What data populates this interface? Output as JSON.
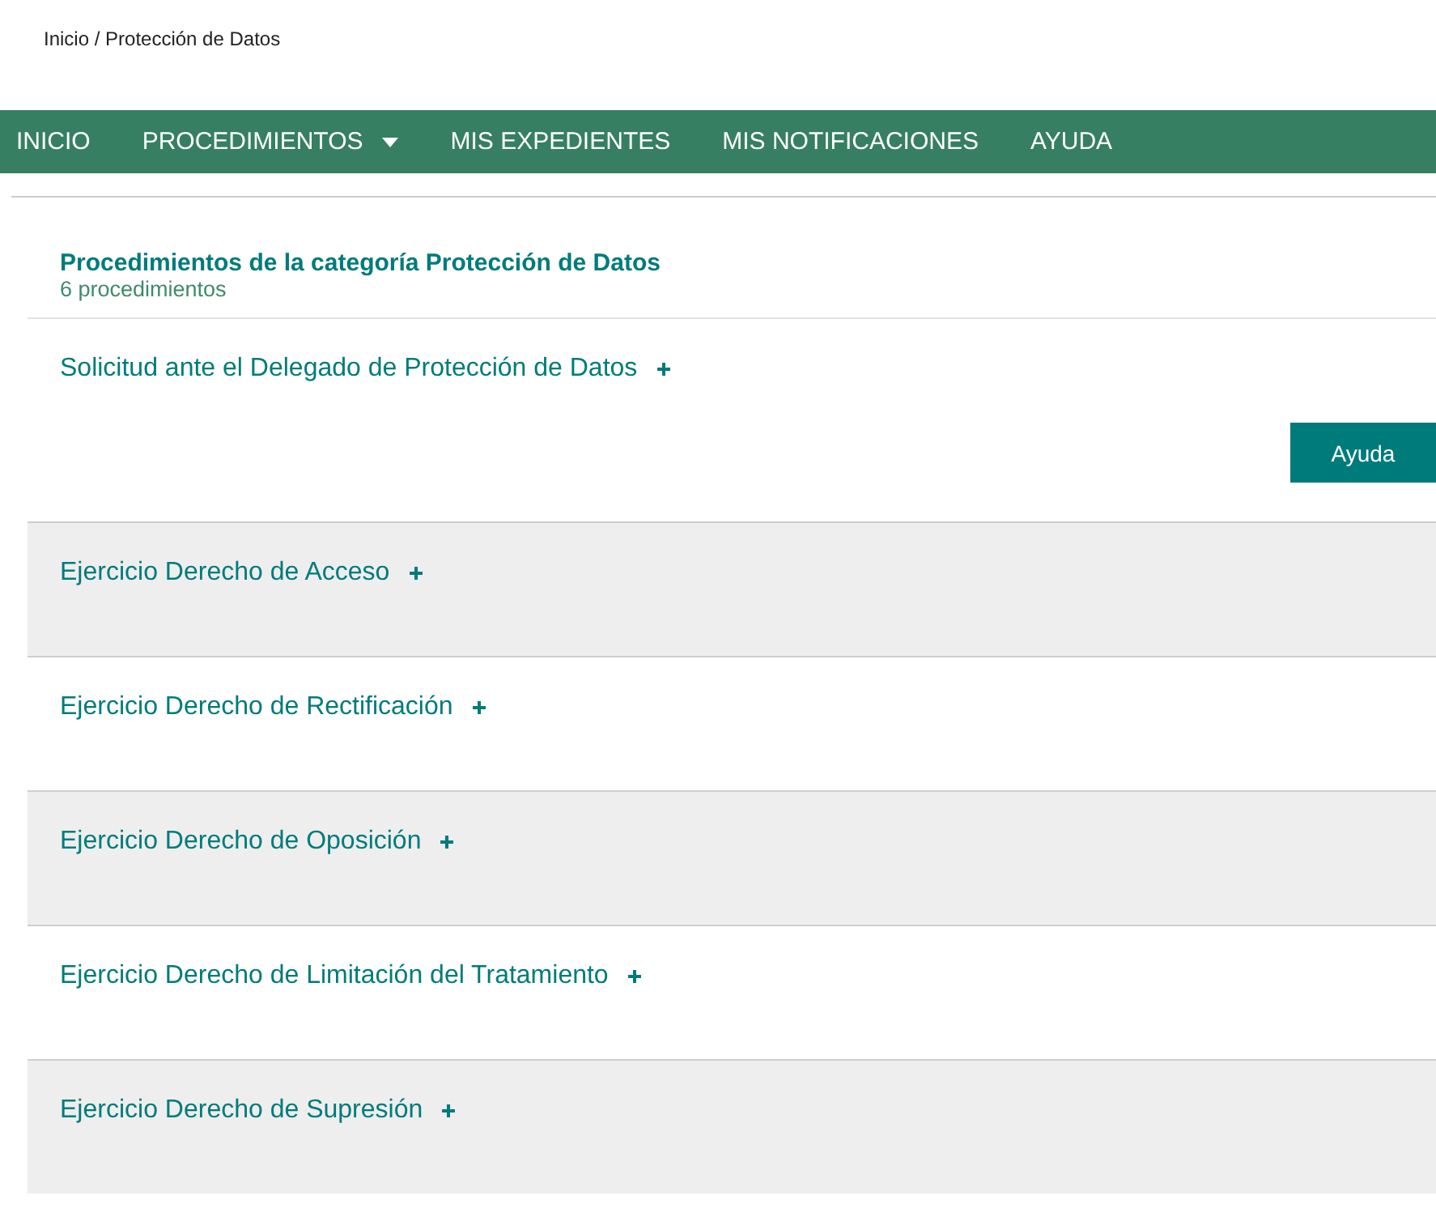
{
  "breadcrumb": "Inicio / Protección de Datos",
  "nav": [
    {
      "label": "INICIO",
      "dropdown": false
    },
    {
      "label": "PROCEDIMIENTOS",
      "dropdown": true
    },
    {
      "label": "MIS EXPEDIENTES",
      "dropdown": false
    },
    {
      "label": "MIS NOTIFICACIONES",
      "dropdown": false
    },
    {
      "label": "AYUDA",
      "dropdown": false
    }
  ],
  "category": {
    "title": "Procedimientos de la categoría Protección de Datos",
    "count": "6 procedimientos"
  },
  "procedures": [
    {
      "title": "Solicitud ante el Delegado de Protección de Datos",
      "help_button": "Ayuda"
    },
    {
      "title": "Ejercicio Derecho de Acceso"
    },
    {
      "title": "Ejercicio Derecho de Rectificación"
    },
    {
      "title": "Ejercicio Derecho de Oposición"
    },
    {
      "title": "Ejercicio Derecho de Limitación del Tratamiento"
    },
    {
      "title": "Ejercicio Derecho de Supresión"
    }
  ]
}
